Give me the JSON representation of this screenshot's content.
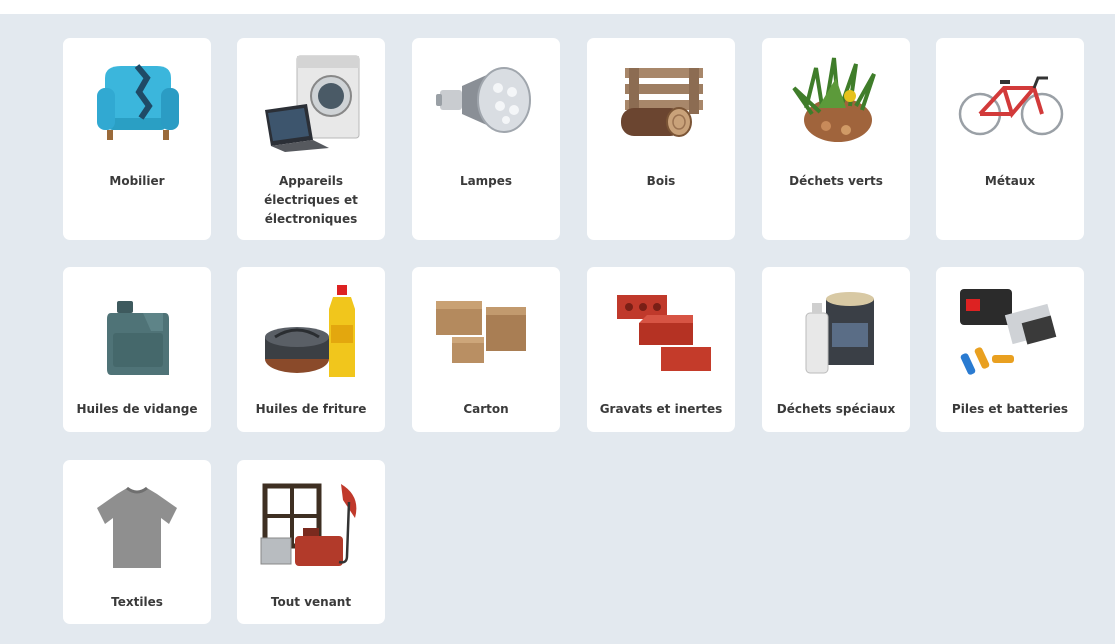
{
  "page": {
    "background": "#e3e9ef",
    "card_background": "#ffffff",
    "text_color": "#3a3a3a"
  },
  "categories": [
    {
      "label": "Mobilier",
      "icon": "armchair-icon"
    },
    {
      "label": "Appareils\nélectriques et\nélectroniques",
      "icon": "washing-machine-laptop-icon"
    },
    {
      "label": "Lampes",
      "icon": "led-bulb-icon"
    },
    {
      "label": "Bois",
      "icon": "wood-pallet-log-icon"
    },
    {
      "label": "Déchets verts",
      "icon": "green-waste-icon"
    },
    {
      "label": "Métaux",
      "icon": "bicycle-icon"
    },
    {
      "label": "Huiles de vidange",
      "icon": "oil-can-icon"
    },
    {
      "label": "Huiles de friture",
      "icon": "frying-oil-icon"
    },
    {
      "label": "Carton",
      "icon": "cardboard-boxes-icon"
    },
    {
      "label": "Gravats et inertes",
      "icon": "bricks-icon"
    },
    {
      "label": "Déchets spéciaux",
      "icon": "paint-can-spray-icon"
    },
    {
      "label": "Piles et batteries",
      "icon": "batteries-icon"
    },
    {
      "label": "Textiles",
      "icon": "tshirt-icon"
    },
    {
      "label": "Tout venant",
      "icon": "mixed-waste-icon"
    }
  ]
}
